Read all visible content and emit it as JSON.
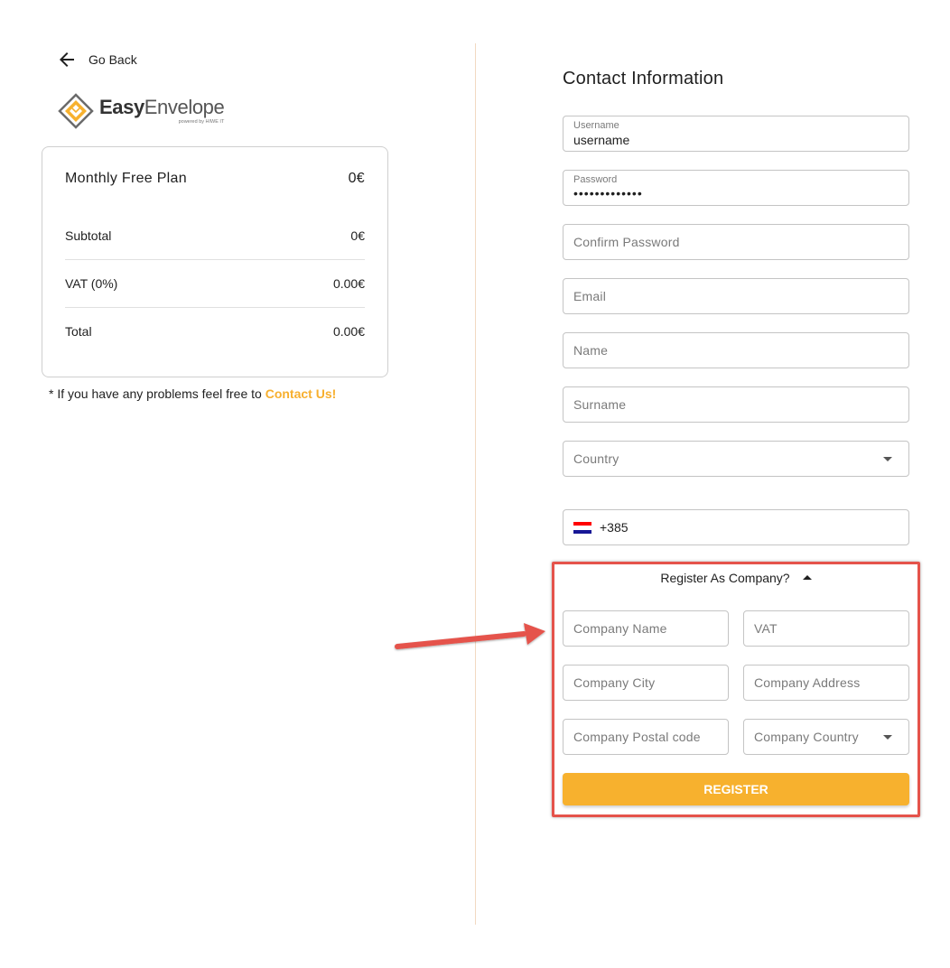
{
  "nav": {
    "go_back_label": "Go Back"
  },
  "brand": {
    "name_bold": "Easy",
    "name_light": "Envelope",
    "tagline": "powered by HIWE IT"
  },
  "summary": {
    "plan_name": "Monthly Free Plan",
    "plan_price": "0€",
    "rows": [
      {
        "label": "Subtotal",
        "value": "0€"
      },
      {
        "label": "VAT (0%)",
        "value": "0.00€"
      },
      {
        "label": "Total",
        "value": "0.00€"
      }
    ]
  },
  "help": {
    "text": "* If you have any problems feel free to ",
    "link": "Contact Us!"
  },
  "form": {
    "title": "Contact Information",
    "username": {
      "label": "Username",
      "value": "username"
    },
    "password": {
      "label": "Password",
      "value": "•••••••••••••"
    },
    "confirm_password": {
      "placeholder": "Confirm Password"
    },
    "email": {
      "placeholder": "Email"
    },
    "name": {
      "placeholder": "Name"
    },
    "surname": {
      "placeholder": "Surname"
    },
    "country": {
      "placeholder": "Country"
    },
    "phone": {
      "value": "+385",
      "flag_colors": [
        "#ff0000",
        "#ffffff",
        "#171796"
      ]
    },
    "company_toggle_label": "Register As Company?",
    "company": {
      "name": {
        "placeholder": "Company Name"
      },
      "vat": {
        "placeholder": "VAT"
      },
      "city": {
        "placeholder": "Company City"
      },
      "address": {
        "placeholder": "Company Address"
      },
      "postal_code": {
        "placeholder": "Company Postal code"
      },
      "country": {
        "placeholder": "Company Country"
      }
    },
    "register_label": "REGISTER"
  },
  "colors": {
    "accent": "#f7b12e",
    "annotation": "#e5534b",
    "link": "#f7af2e"
  }
}
